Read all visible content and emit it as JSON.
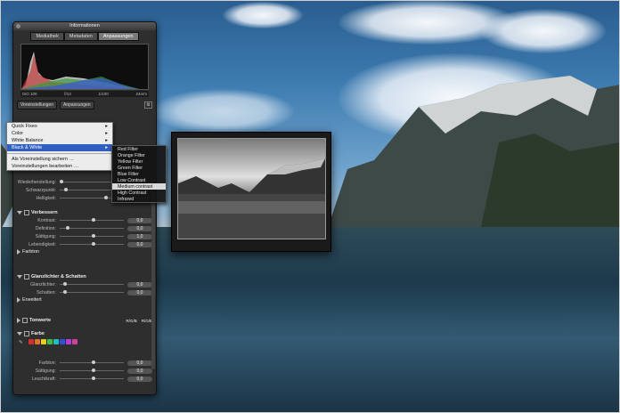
{
  "panel": {
    "title": "Informationen",
    "tabs": [
      {
        "label": "Mediathek",
        "active": false
      },
      {
        "label": "Metadaten",
        "active": false
      },
      {
        "label": "Anpassungen",
        "active": true
      }
    ],
    "exif": [
      "ISO 100",
      "f/13",
      "1/100",
      "24mm"
    ],
    "preset_dropdown": "Voreinstellungen",
    "adjust_dropdown": "Anpassungen"
  },
  "presets_menu": {
    "items": [
      {
        "label": "Quick Fixes",
        "has_sub": true
      },
      {
        "label": "Color",
        "has_sub": true
      },
      {
        "label": "White Balance",
        "has_sub": true
      },
      {
        "label": "Black & White",
        "has_sub": true,
        "selected": true
      }
    ],
    "items2": [
      {
        "label": "Als Voreinstellung sichern …"
      },
      {
        "label": "Voreinstellungen bearbeiten …"
      }
    ]
  },
  "bw_submenu": [
    {
      "label": "Red Filter"
    },
    {
      "label": "Orange Filter"
    },
    {
      "label": "Yellow Filter"
    },
    {
      "label": "Green Filter"
    },
    {
      "label": "Blue Filter"
    },
    {
      "label": "Low Contrast"
    },
    {
      "label": "Medium contrast",
      "selected": true
    },
    {
      "label": "High Contrast"
    },
    {
      "label": "Infrared"
    }
  ],
  "level_rows": [
    {
      "label": "Wiederherstellung:"
    },
    {
      "label": "Schwarzpunkt:"
    },
    {
      "label": "Helligkeit:"
    }
  ],
  "verbessern": {
    "title": "Verbessern",
    "rows": [
      {
        "label": "Kontrast:",
        "value": "0,0",
        "pos": 0.5
      },
      {
        "label": "Definition:",
        "value": "0,0",
        "pos": 0.1
      },
      {
        "label": "Sättigung:",
        "value": "1,0",
        "pos": 0.5
      },
      {
        "label": "Lebendigkeit:",
        "value": "0,0",
        "pos": 0.5
      }
    ],
    "sub": "Farbton"
  },
  "glanzlichter": {
    "title": "Glanzlichter & Schatten",
    "rows": [
      {
        "label": "Glanzlichter:",
        "value": "0,0",
        "pos": 0.05
      },
      {
        "label": "Schatten:",
        "value": "0,0",
        "pos": 0.05
      }
    ],
    "sub": "Erweitert"
  },
  "tonwerte": {
    "title": "Tonwerte",
    "right1": "R/G/B",
    "right2": "R/G/B"
  },
  "farbe": {
    "title": "Farbe",
    "swatches": [
      "#d23030",
      "#e07020",
      "#e0d020",
      "#40c040",
      "#20c0c0",
      "#3050e0",
      "#b040d0",
      "#d040a0"
    ],
    "rows": [
      {
        "label": "Farbton:",
        "value": "0,0",
        "pos": 0.5
      },
      {
        "label": "Sättigung:",
        "value": "0,0",
        "pos": 0.5
      },
      {
        "label": "Leuchtkraft:",
        "value": "0,0",
        "pos": 0.5
      }
    ]
  }
}
